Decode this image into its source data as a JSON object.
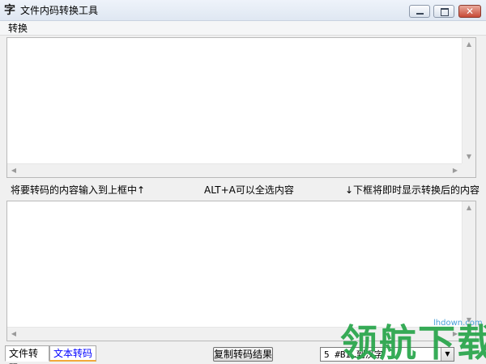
{
  "window": {
    "app_icon": "字",
    "title": "文件内码转换工具",
    "close_symbol": "✕"
  },
  "menu": {
    "items": [
      {
        "label": "转换"
      }
    ]
  },
  "input_box": {
    "value": ""
  },
  "output_box": {
    "value": ""
  },
  "hints": {
    "left": "将要转码的内容输入到上框中↑",
    "center": "ALT+A可以全选内容",
    "right": "↓下框将即时显示转换后的内容"
  },
  "tabs": [
    {
      "label": "文件转码"
    },
    {
      "label": "文本转码"
    }
  ],
  "copy_button": {
    "label": "复制转码结果"
  },
  "mode_select": {
    "selected": "5 #BI…到汉字"
  },
  "watermark": {
    "text": "领航下载",
    "url": "lhdown.com"
  },
  "icons": {
    "up": "▲",
    "down": "▼",
    "left": "◀",
    "right": "▶"
  },
  "colors": {
    "tab_text_active": "#0000ff",
    "watermark": "#27a54a"
  }
}
